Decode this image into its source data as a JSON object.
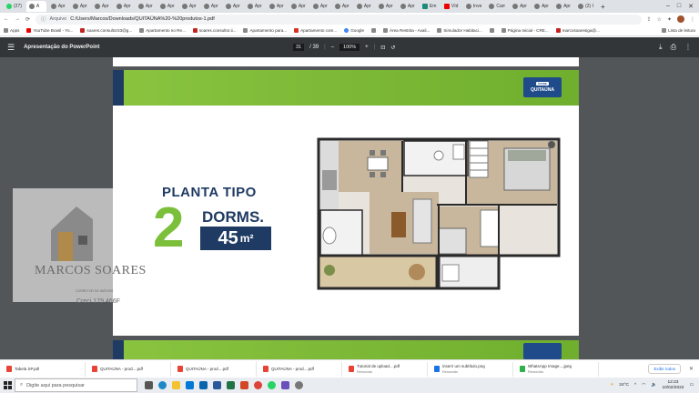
{
  "browser": {
    "tabs": [
      {
        "label": "(27)",
        "fav": "wa"
      },
      {
        "label": "A",
        "fav": "gray",
        "active": true
      },
      {
        "label": "Apr",
        "fav": "gray"
      },
      {
        "label": "Apr",
        "fav": "gray"
      },
      {
        "label": "Apr",
        "fav": "gray"
      },
      {
        "label": "Apr",
        "fav": "gray"
      },
      {
        "label": "Apr",
        "fav": "gray"
      },
      {
        "label": "Apr",
        "fav": "gray"
      },
      {
        "label": "Apr",
        "fav": "gray"
      },
      {
        "label": "Apr",
        "fav": "gray"
      },
      {
        "label": "Apr",
        "fav": "gray"
      },
      {
        "label": "Apr",
        "fav": "gray"
      },
      {
        "label": "Apr",
        "fav": "gray"
      },
      {
        "label": "Apr",
        "fav": "gray"
      },
      {
        "label": "Apr",
        "fav": "gray"
      },
      {
        "label": "Apr",
        "fav": "gray"
      },
      {
        "label": "Apr",
        "fav": "gray"
      },
      {
        "label": "Apr",
        "fav": "gray"
      },
      {
        "label": "Apr",
        "fav": "gray"
      },
      {
        "label": "Em",
        "fav": "teal"
      },
      {
        "label": "Víd",
        "fav": "yt"
      },
      {
        "label": "Inve",
        "fav": "gray"
      },
      {
        "label": "Carr",
        "fav": "gray"
      },
      {
        "label": "Apr",
        "fav": "gray"
      },
      {
        "label": "Apr",
        "fav": "gray"
      },
      {
        "label": "Apr",
        "fav": "gray"
      },
      {
        "label": "(2) I",
        "fav": "gray"
      }
    ],
    "new_tab": "+",
    "window_controls": [
      "–",
      "□",
      "✕"
    ],
    "address_secure_label": "Arquivo",
    "address_url": "C:/Users/Marcos/Downloads/QUITAÚNA%20-%20produtos-1.pdf",
    "bookmarks": [
      {
        "label": "Apps",
        "icon": "grid"
      },
      {
        "label": "YouTube Brasil - Yo...",
        "icon": "yt"
      },
      {
        "label": "soares.consultor33@g...",
        "icon": "m"
      },
      {
        "label": "Apartamento no Re...",
        "icon": "gray"
      },
      {
        "label": "soares.consultor.ii...",
        "icon": "m"
      },
      {
        "label": "Apartamento para...",
        "icon": "gray"
      },
      {
        "label": "Apartamento com...",
        "icon": "z"
      },
      {
        "label": "Google",
        "icon": "g"
      },
      {
        "label": "",
        "icon": "gray"
      },
      {
        "label": "Área Restrita - Avali...",
        "icon": "gray"
      },
      {
        "label": "Simulador Habitaci...",
        "icon": "gray"
      },
      {
        "label": "",
        "icon": "gray"
      },
      {
        "label": "Página Inicial - CRE...",
        "icon": "gray"
      },
      {
        "label": "marcosoaresiga@...",
        "icon": "m"
      }
    ],
    "reading_list": "Lista de leitura"
  },
  "pdf_toolbar": {
    "title": "Apresentação do PowerPoint",
    "page_current": "31",
    "page_total": "/ 39",
    "zoom": "100%",
    "zoom_out": "–",
    "zoom_in": "+"
  },
  "slide": {
    "logo_tag": "ÍCONE",
    "logo_name": "QUITAÚNA",
    "planta": "PLANTA TIPO",
    "number": "2",
    "dorms": "DORMS.",
    "area_value": "45",
    "area_unit": "m²"
  },
  "watermark": {
    "name": "MARCOS SOARES",
    "subtitle": "CORRETOR DE IMÓVEIS",
    "creci": "Creci 179.466F"
  },
  "downloads": [
    {
      "name": "Tabela SP.pdf",
      "status": "",
      "type": "pdf"
    },
    {
      "name": "QUITAÚNA - prod....pdf",
      "status": "",
      "type": "pdf"
    },
    {
      "name": "QUITAÚNA - prod....pdf",
      "status": "",
      "type": "pdf"
    },
    {
      "name": "QUITAÚNA - prod....pdf",
      "status": "",
      "type": "pdf"
    },
    {
      "name": "Tutorial de upload....pdf",
      "status": "Removido",
      "type": "pdf"
    },
    {
      "name": "inserir um subtítulo.png",
      "status": "Removido",
      "type": "png"
    },
    {
      "name": "WhatsApp Image....jpeg",
      "status": "Removido",
      "type": "wa"
    }
  ],
  "downloads_show_all": "Exibir todos",
  "taskbar": {
    "search_placeholder": "Digite aqui para pesquisar",
    "temperature": "24°C",
    "time": "12:23",
    "date": "10/02/2022"
  }
}
